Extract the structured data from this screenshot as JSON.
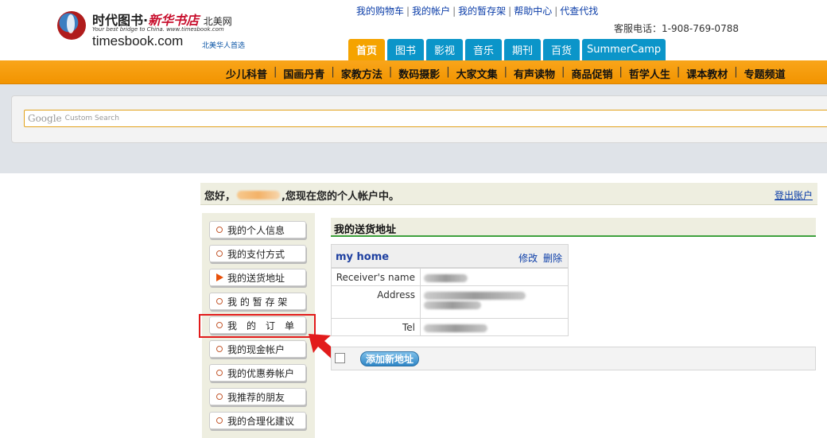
{
  "logo": {
    "cn_title": "时代图书·",
    "xinhua": "新华书店",
    "north_america": "北美网",
    "tagline": "Your best bridge to China. www.timesbook.com",
    "domain": "timesbook.com",
    "slogan": "北美华人首选"
  },
  "toplinks": [
    "我的购物车",
    "我的帐户",
    "我的暂存架",
    "帮助中心",
    "代查代找"
  ],
  "phone": "客服电话：1-908-769-0788",
  "tabs": [
    {
      "label": "首页",
      "active": true
    },
    {
      "label": "图书"
    },
    {
      "label": "影视"
    },
    {
      "label": "音乐"
    },
    {
      "label": "期刊"
    },
    {
      "label": "百货"
    },
    {
      "label": "SummerCamp"
    }
  ],
  "nav": [
    "少儿科普",
    "国画丹青",
    "家教方法",
    "数码摄影",
    "大家文集",
    "有声读物",
    "商品促销",
    "哲学人生",
    "课本教材",
    "专题频道"
  ],
  "search": {
    "brand": "Google",
    "placeholder": "Custom Search"
  },
  "account": {
    "greeting_prefix": "您好，",
    "greeting_suffix": ",您现在您的个人帐户中。",
    "logout": "登出账户"
  },
  "sidebar": [
    {
      "label": "我的个人信息",
      "active": false
    },
    {
      "label": "我的支付方式",
      "active": false
    },
    {
      "label": "我的送货地址",
      "active": true
    },
    {
      "label": "我 的 暂 存 架",
      "active": false
    },
    {
      "label": "我　的　订　单",
      "active": false,
      "highlighted": true
    },
    {
      "label": "我的现金帐户",
      "active": false
    },
    {
      "label": "我的优惠券帐户",
      "active": false
    },
    {
      "label": "我推荐的朋友",
      "active": false
    },
    {
      "label": "我的合理化建议",
      "active": false
    }
  ],
  "content": {
    "title": "我的送货地址",
    "address": {
      "name": "my home",
      "edit": "修改",
      "delete": "删除",
      "receiver_label": "Receiver's name",
      "address_label": "Address",
      "tel_label": "Tel"
    },
    "add_button": "添加新地址"
  },
  "colors": {
    "tab_blue": "#0b95c9",
    "tab_active": "#f5a300",
    "nav_orange": "#f29400",
    "highlight_red": "#e21b1b"
  }
}
